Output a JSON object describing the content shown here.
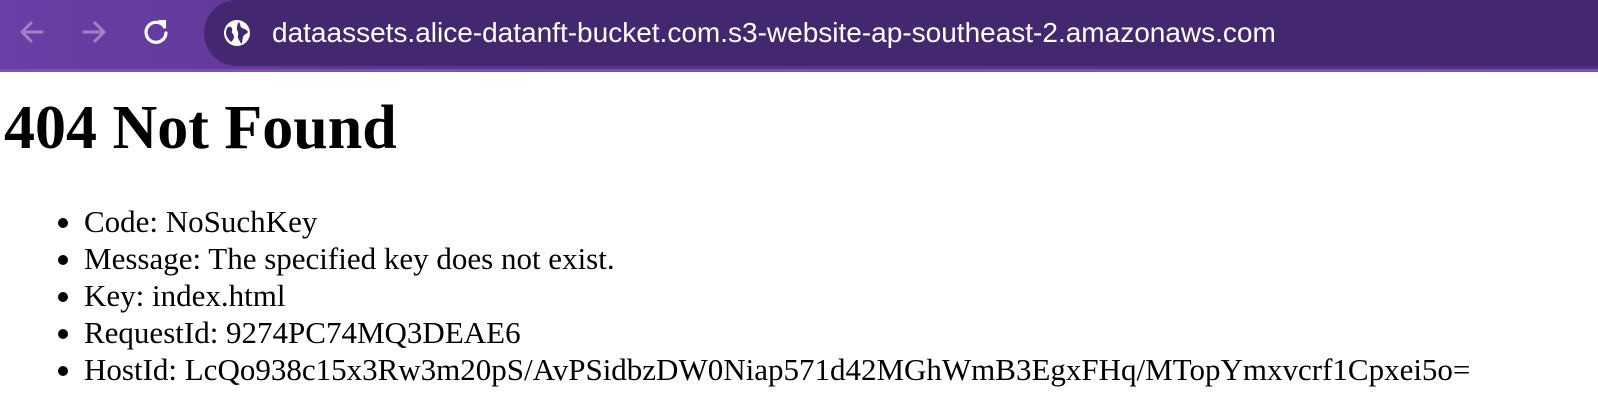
{
  "browser": {
    "url": "dataassets.alice-datanft-bucket.com.s3-website-ap-southeast-2.amazonaws.com",
    "icons": {
      "back": "arrow-left-icon",
      "forward": "arrow-right-icon",
      "reload": "reload-icon",
      "site_info": "globe-icon"
    },
    "colors": {
      "toolbar": "#5a3490",
      "omnibox": "#43286f"
    }
  },
  "page": {
    "title": "404 Not Found",
    "details": [
      "Code: NoSuchKey",
      "Message: The specified key does not exist.",
      "Key: index.html",
      "RequestId: 9274PC74MQ3DEAE6",
      "HostId: LcQo938c15x3Rw3m20pS/AvPSidbzDW0Niap571d42MGhWmB3EgxFHq/MTopYmxvcrf1Cpxei5o="
    ]
  }
}
